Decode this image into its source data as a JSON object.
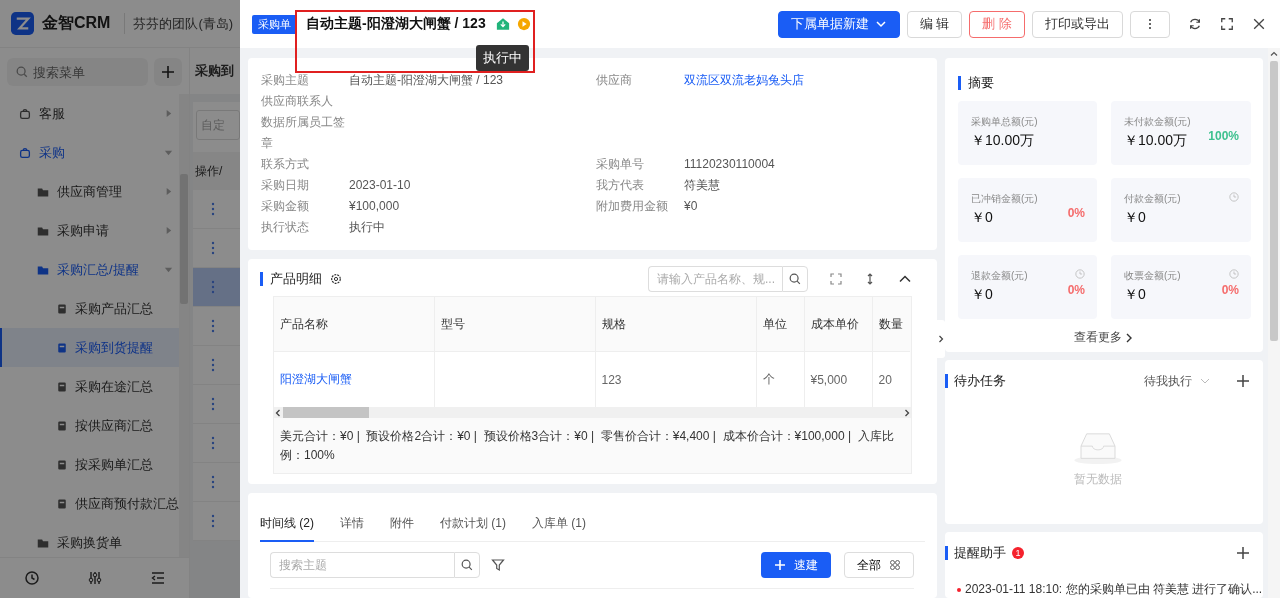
{
  "app": {
    "brand": "金智CRM",
    "team": "芬芬的团队(青岛)",
    "menu_search": {
      "placeholder": "搜索菜单"
    },
    "menu": [
      {
        "label": "客服",
        "expanded": false,
        "selected": false
      },
      {
        "label": "采购",
        "expanded": true,
        "selected": true,
        "children": [
          {
            "label": "供应商管理",
            "expanded": false,
            "selected": false
          },
          {
            "label": "采购申请",
            "expanded": false,
            "selected": false
          },
          {
            "label": "采购汇总/提醒",
            "expanded": true,
            "selected": true,
            "children": [
              {
                "label": "采购产品汇总",
                "selected": false
              },
              {
                "label": "采购到货提醒",
                "selected": true
              },
              {
                "label": "采购在途汇总",
                "selected": false
              },
              {
                "label": "按供应商汇总",
                "selected": false
              },
              {
                "label": "按采购单汇总",
                "selected": false
              },
              {
                "label": "供应商预付款汇总",
                "selected": false
              }
            ]
          },
          {
            "label": "采购换货单",
            "selected": false
          }
        ]
      }
    ],
    "page_title": "采购到",
    "filter_field": {
      "placeholder": "自定"
    },
    "table_header": "操作/",
    "rows": [
      {
        "selected": false
      },
      {
        "selected": false
      },
      {
        "selected": true
      },
      {
        "selected": false
      },
      {
        "selected": false
      },
      {
        "selected": false
      },
      {
        "selected": false
      },
      {
        "selected": false
      },
      {
        "selected": false
      }
    ]
  },
  "drawer": {
    "tag": "采购单",
    "title": "自动主题-阳澄湖大闸蟹 / 123",
    "tooltip": "执行中",
    "buttons": [
      {
        "label": "下属单据新建",
        "kind": "primary"
      },
      {
        "label": "编 辑",
        "kind": "default"
      },
      {
        "label": "删 除",
        "kind": "danger"
      },
      {
        "label": "打印或导出",
        "kind": "default"
      }
    ],
    "details": [
      [
        {
          "label": "采购主题",
          "value": "自动主题-阳澄湖大闸蟹 / 123"
        },
        {
          "label": "供应商",
          "value": "双流区双流老妈兔头店",
          "link": true
        }
      ],
      [
        {
          "label": "供应商联系人"
        }
      ],
      [
        {
          "label": "数据所属员工签章"
        }
      ],
      [
        {
          "label": "联系方式"
        },
        {
          "label": "采购单号",
          "value": "11120230110004"
        }
      ],
      [
        {
          "label": "采购日期",
          "value": "2023-01-10"
        },
        {
          "label": "我方代表",
          "value": "符美慧"
        }
      ],
      [
        {
          "label": "采购金额",
          "value": "¥100,000"
        },
        {
          "label": "附加费用金额",
          "value": "¥0"
        }
      ],
      [
        {
          "label": "执行状态",
          "value": "执行中"
        }
      ]
    ],
    "products": {
      "title": "产品明细",
      "search": {
        "placeholder": "请输入产品名称、规..."
      },
      "columns": [
        "产品名称",
        "型号",
        "规格",
        "单位",
        "成本单价",
        "数量"
      ],
      "rows": [
        {
          "name": "阳澄湖大闸蟹",
          "spec": "123",
          "unit": "个",
          "cost": "¥5,000",
          "qty": "20"
        }
      ],
      "summary": "美元合计：¥0 |  预设价格2合计：¥0 |  预设价格3合计：¥0 |  零售价合计：¥4,400 |  成本价合计：¥100,000 |  入库比例：100%"
    },
    "tabs": [
      {
        "label": "时间线 (2)",
        "selected": true
      },
      {
        "label": "详情",
        "selected": false
      },
      {
        "label": "附件",
        "selected": false
      },
      {
        "label": "付款计划 (1)",
        "selected": false
      },
      {
        "label": "入库单 (1)",
        "selected": false
      }
    ],
    "timeline": {
      "search": {
        "placeholder": "搜索主题"
      },
      "quick_button": "速建",
      "all_button": "全部"
    },
    "summary": {
      "title": "摘要",
      "tiles": [
        {
          "label": "采购单总额(元)",
          "value": "￥10.00万",
          "clock": false
        },
        {
          "label": "未付款金额(元)",
          "value": "￥10.00万",
          "percent": "100%",
          "color": "#3ec18f",
          "clock": false
        },
        {
          "label": "已冲销金额(元)",
          "value": "￥0",
          "percent": "0%",
          "color": "#f56c6c",
          "clock": false
        },
        {
          "label": "付款金额(元)",
          "value": "￥0",
          "clock": true
        },
        {
          "label": "退款金额(元)",
          "value": "￥0",
          "percent": "0%",
          "color": "#f56c6c",
          "clock": true
        },
        {
          "label": "收票金额(元)",
          "value": "￥0",
          "percent": "0%",
          "color": "#f56c6c",
          "clock": true
        }
      ],
      "more": "查看更多"
    },
    "todo": {
      "title": "待办任务",
      "filter": "待我执行",
      "empty": "暂无数据"
    },
    "reminders": {
      "title": "提醒助手",
      "badge": "1",
      "items": [
        {
          "text": "2023-01-11 18:10: 您的采购单已由 符美慧 进行了确认..."
        }
      ]
    }
  }
}
